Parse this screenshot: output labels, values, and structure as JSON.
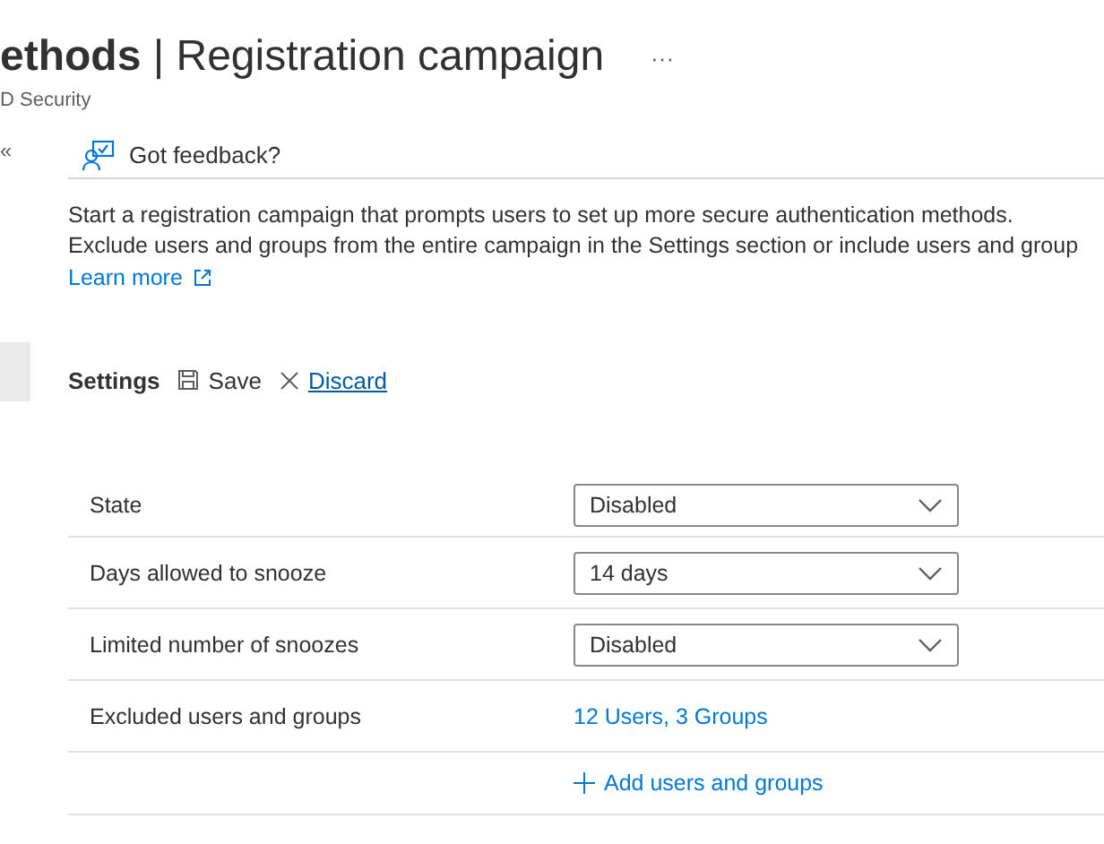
{
  "header": {
    "title_bold": "ethods",
    "separator": "|",
    "title_rest": "Registration campaign",
    "more": "···",
    "subtitle": "D Security"
  },
  "sidebar": {
    "collapse": "«",
    "items": [
      {
        "selected": true
      }
    ]
  },
  "toolbar": {
    "feedback": "Got feedback?"
  },
  "description": {
    "lines": [
      "Start a registration campaign that prompts users to set up more secure authentication methods.",
      "Exclude users and groups from the entire campaign in the Settings section or include users and group"
    ],
    "link": "Learn more"
  },
  "settings_bar": {
    "title": "Settings",
    "save": "Save",
    "discard": "Discard"
  },
  "settings": [
    {
      "kind": "dropdown",
      "label": "State",
      "value": "Disabled"
    },
    {
      "kind": "dropdown",
      "label": "Days allowed to snooze",
      "value": "14 days"
    },
    {
      "kind": "dropdown",
      "label": "Limited number of snoozes",
      "value": "Disabled"
    },
    {
      "kind": "link",
      "label": "Excluded users and groups",
      "value": "12 Users, 3 Groups"
    },
    {
      "kind": "add",
      "value": "Add users and groups"
    }
  ]
}
